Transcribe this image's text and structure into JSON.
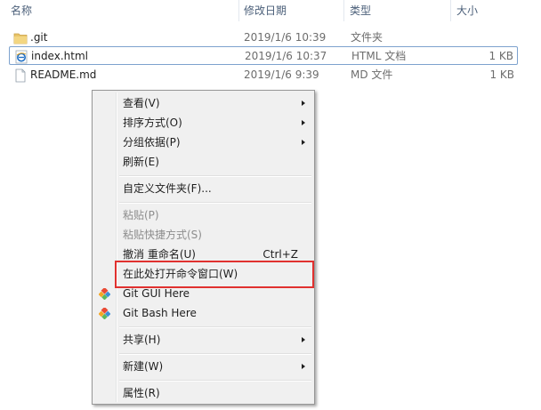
{
  "header": {
    "name": "名称",
    "date": "修改日期",
    "type": "类型",
    "size": "大小"
  },
  "files": [
    {
      "name": ".git",
      "date": "2019/1/6 10:39",
      "type": "文件夹",
      "size": "",
      "icon": "folder-icon"
    },
    {
      "name": "index.html",
      "date": "2019/1/6 10:37",
      "type": "HTML 文档",
      "size": "1 KB",
      "icon": "html-document-icon"
    },
    {
      "name": "README.md",
      "date": "2019/1/6 9:39",
      "type": "MD 文件",
      "size": "1 KB",
      "icon": "blank-file-icon"
    }
  ],
  "menu": {
    "view": "查看(V)",
    "sort": "排序方式(O)",
    "group": "分组依据(P)",
    "refresh": "刷新(E)",
    "customize": "自定义文件夹(F)...",
    "paste": "粘贴(P)",
    "paste_shortcut": "粘贴快捷方式(S)",
    "undo": "撤消 重命名(U)",
    "undo_shortcut": "Ctrl+Z",
    "open_cmd": "在此处打开命令窗口(W)",
    "git_gui": "Git GUI Here",
    "git_bash": "Git Bash Here",
    "share": "共享(H)",
    "new": "新建(W)",
    "properties": "属性(R)"
  },
  "colors": {
    "highlight_box": "#e0312f",
    "selection_border": "#7da2ce",
    "header_text": "#4c607a"
  }
}
